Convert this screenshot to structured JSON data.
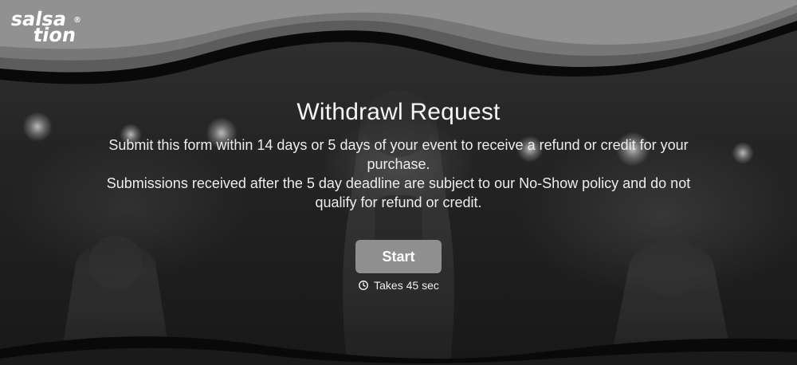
{
  "brand": {
    "logo_line1": "salsa",
    "logo_line2": "tion",
    "registered_mark": "®"
  },
  "hero": {
    "title": "Withdrawl Request",
    "description_lines": [
      "Submit this form within 14 days or 5 days of your event to receive a refund or credit for your purchase.",
      "Submissions received after the 5 day deadline are subject to our No-Show policy and do not qualify for refund or credit."
    ],
    "start_button_label": "Start",
    "time_estimate": "Takes 45 sec"
  },
  "icons": {
    "clock": "clock-icon"
  },
  "colors": {
    "button_bg": "#8f8f8f",
    "text_primary": "#f6f6f6",
    "background_dark": "#111111"
  }
}
